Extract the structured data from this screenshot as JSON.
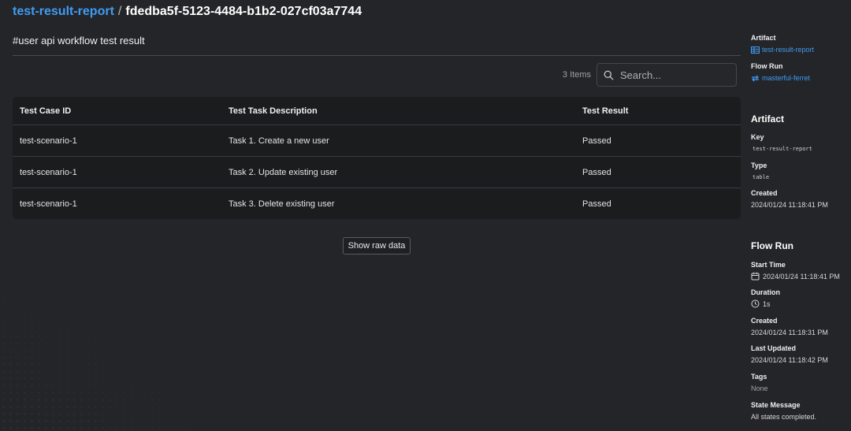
{
  "header": {
    "artifact_name": "test-result-report",
    "separator": "/",
    "artifact_id": "fdedba5f-5123-4484-b1b2-027cf03a7744"
  },
  "description": "#user api workflow test result",
  "table": {
    "item_count": "3 Items",
    "search_placeholder": "Search...",
    "columns": [
      "Test Case ID",
      "Test Task Description",
      "Test Result"
    ],
    "rows": [
      [
        "test-scenario-1",
        "Task 1. Create a new user",
        "Passed"
      ],
      [
        "test-scenario-1",
        "Task 2. Update existing user",
        "Passed"
      ],
      [
        "test-scenario-1",
        "Task 3. Delete existing user",
        "Passed"
      ]
    ]
  },
  "show_raw_label": "Show raw data",
  "sidebar": {
    "artifact_label": "Artifact",
    "artifact_link": "test-result-report",
    "flow_run_label": "Flow Run",
    "flow_run_link": "masterful-ferret",
    "artifact_section": {
      "title": "Artifact",
      "key_label": "Key",
      "key_value": "test-result-report",
      "type_label": "Type",
      "type_value": "table",
      "created_label": "Created",
      "created_value": "2024/01/24 11:18:41 PM"
    },
    "flow_run_section": {
      "title": "Flow Run",
      "start_time_label": "Start Time",
      "start_time_value": "2024/01/24 11:18:41 PM",
      "duration_label": "Duration",
      "duration_value": "1s",
      "created_label": "Created",
      "created_value": "2024/01/24 11:18:31 PM",
      "last_updated_label": "Last Updated",
      "last_updated_value": "2024/01/24 11:18:42 PM",
      "tags_label": "Tags",
      "tags_value": "None",
      "state_message_label": "State Message",
      "state_message_value": "All states completed."
    }
  },
  "icons": {
    "artifact": "table-icon",
    "flow_run": "flow-run-icon",
    "start_time": "calendar-icon",
    "duration": "clock-icon",
    "search": "search-icon"
  },
  "colors": {
    "accent": "#3f9cf5",
    "background": "#242528",
    "table_background": "#1b1c1e"
  }
}
